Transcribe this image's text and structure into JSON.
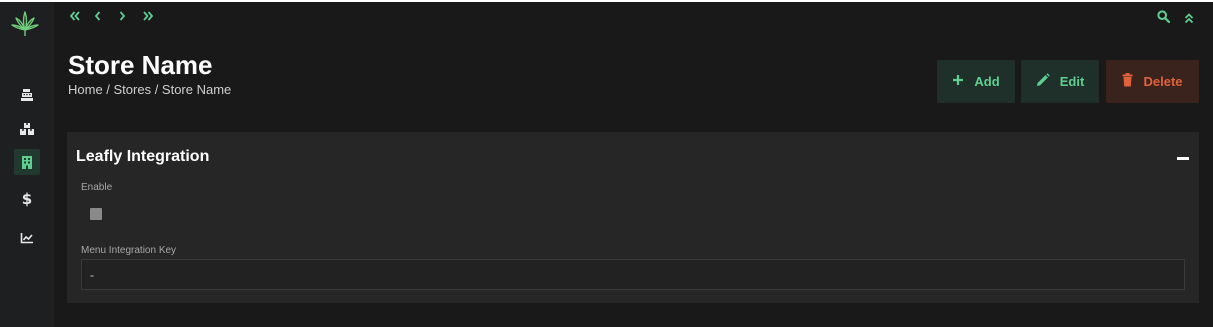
{
  "sidebar": {
    "logo": "cannabis-leaf-logo",
    "items": [
      {
        "icon": "cash-register-icon",
        "active": false
      },
      {
        "icon": "boxes-icon",
        "active": false
      },
      {
        "icon": "building-icon",
        "active": true
      },
      {
        "icon": "dollar-icon",
        "label": "$",
        "active": false
      },
      {
        "icon": "chart-line-icon",
        "active": false
      }
    ]
  },
  "topbar": {
    "nav_icons": [
      "double-left-icon",
      "chevron-left-icon",
      "chevron-right-icon",
      "double-right-icon"
    ],
    "right_icons": [
      "search-icon",
      "double-up-icon"
    ]
  },
  "header": {
    "title": "Store Name",
    "breadcrumb": "Home / Stores / Store Name"
  },
  "actions": {
    "add_label": "Add",
    "edit_label": "Edit",
    "delete_label": "Delete"
  },
  "card": {
    "title": "Leafly Integration",
    "enable_label": "Enable",
    "enable_checked": false,
    "menu_key_label": "Menu Integration Key",
    "menu_key_value": "-"
  },
  "colors": {
    "accent_green": "#5fcf8f",
    "danger_orange": "#e0623a",
    "background": "#191919",
    "card": "#262626"
  }
}
